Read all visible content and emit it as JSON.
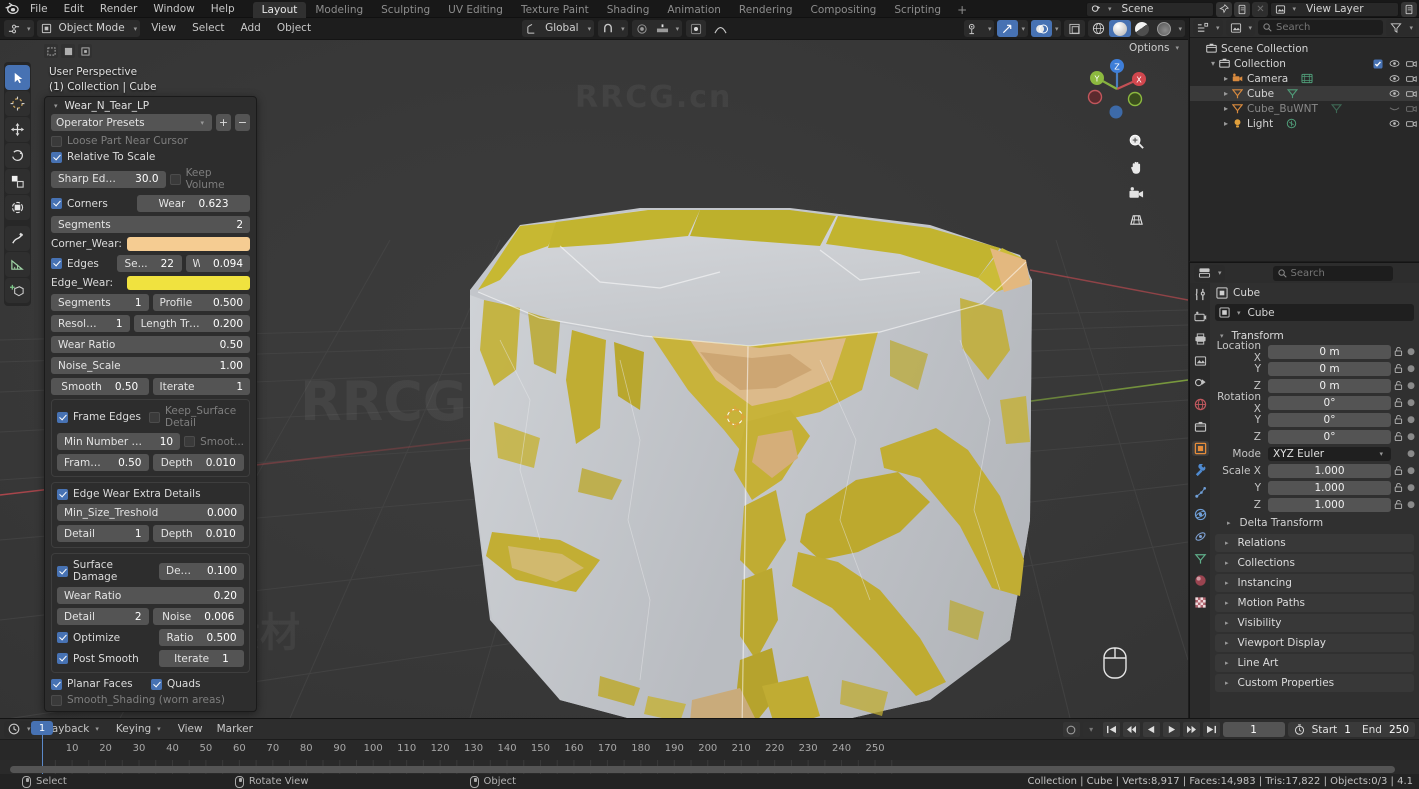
{
  "app": {
    "name": "Blender",
    "version": "4.1"
  },
  "topbar": {
    "menus": [
      "File",
      "Edit",
      "Render",
      "Window",
      "Help"
    ],
    "workspaces": [
      {
        "label": "Layout",
        "active": true
      },
      {
        "label": "Modeling",
        "active": false
      },
      {
        "label": "Sculpting",
        "active": false
      },
      {
        "label": "UV Editing",
        "active": false
      },
      {
        "label": "Texture Paint",
        "active": false
      },
      {
        "label": "Shading",
        "active": false
      },
      {
        "label": "Animation",
        "active": false
      },
      {
        "label": "Rendering",
        "active": false
      },
      {
        "label": "Compositing",
        "active": false
      },
      {
        "label": "Scripting",
        "active": false
      }
    ],
    "add_workspace_label": "+",
    "scene_name": "Scene",
    "view_layer_name": "View Layer"
  },
  "viewport_header": {
    "mode": "Object Mode",
    "menus": [
      "View",
      "Select",
      "Add",
      "Object"
    ],
    "transform_orientation": "Global",
    "options_label": "Options"
  },
  "viewport": {
    "overlay_line1": "User Perspective",
    "overlay_line2": "(1) Collection | Cube",
    "gizmo_axes": [
      "X",
      "Y",
      "Z"
    ],
    "tools": [
      "tweak-select-tool",
      "cursor-tool",
      "move-tool",
      "rotate-tool",
      "scale-tool",
      "transform-tool",
      "annotate-tool",
      "measure-tool",
      "add-cube-tool"
    ],
    "nav_icons": [
      "zoom-icon",
      "pan-hand-icon",
      "camera-view-icon",
      "perspective-ortho-icon"
    ],
    "watermarks": [
      "RRCG.cn",
      "RRCG",
      "人人素材"
    ]
  },
  "operator_panel": {
    "title": "Wear_N_Tear_LP",
    "presets_label": "Operator Presets",
    "preset_add": "+",
    "preset_remove": "−",
    "fields": {
      "loose_part_near_cursor": {
        "label": "Loose Part Near Cursor",
        "checked": false,
        "enabled": false
      },
      "relative_to_scale": {
        "label": "Relative To Scale",
        "checked": true
      },
      "sharp_edge_angle": {
        "label": "Sharp Edge Angle",
        "value": "30.0"
      },
      "keep_volume": {
        "label": "Keep Volume",
        "checked": false
      },
      "corners": {
        "label": "Corners",
        "checked": true
      },
      "corners_wear": {
        "label": "Wear",
        "value": "0.623"
      },
      "corners_segments": {
        "label": "Segments",
        "value": "2"
      },
      "corner_wear_color_label": "Corner_Wear:",
      "corner_wear_color": "#f5cc92",
      "edges": {
        "label": "Edges",
        "checked": true
      },
      "edges_seg": {
        "label": "Se...",
        "value": "22"
      },
      "edges_wear": {
        "label": "Wear",
        "value": "0.094"
      },
      "edge_wear_color_label": "Edge_Wear:",
      "edge_wear_color": "#f0e23f",
      "segments": {
        "label": "Segments",
        "value": "1"
      },
      "profile": {
        "label": "Profile",
        "value": "0.500"
      },
      "resolution": {
        "label": "Resolution",
        "value": "1"
      },
      "length_treshold": {
        "label": "Length Treshold",
        "value": "0.200"
      },
      "wear_ratio_1": {
        "label": "Wear Ratio",
        "value": "0.50"
      },
      "noise_scale": {
        "label": "Noise_Scale",
        "value": "1.00"
      },
      "smooth": {
        "label": "Smooth",
        "value": "0.50"
      },
      "iterate_1": {
        "label": "Iterate",
        "value": "1"
      },
      "frame_edges": {
        "label": "Frame Edges",
        "checked": true
      },
      "keep_surface_detail": {
        "label": "Keep_Surface Detail",
        "checked": false,
        "enabled": false
      },
      "min_number_of_edges": {
        "label": "Min Number Of Edges",
        "value": "10"
      },
      "smoot": {
        "label": "Smoot...",
        "checked": false,
        "enabled": false
      },
      "frame_inset": {
        "label": "Frame Inset",
        "value": "0.50"
      },
      "frame_depth": {
        "label": "Depth",
        "value": "0.010"
      },
      "edge_wear_extra_details": {
        "label": "Edge Wear Extra Details",
        "checked": true
      },
      "min_size_treshold": {
        "label": "Min_Size_Treshold",
        "value": "0.000"
      },
      "extra_detail": {
        "label": "Detail",
        "value": "1"
      },
      "extra_depth": {
        "label": "Depth",
        "value": "0.010"
      },
      "surface_damage": {
        "label": "Surface Damage",
        "checked": true
      },
      "surface_depth": {
        "label": "Depth",
        "value": "0.100"
      },
      "wear_ratio_2": {
        "label": "Wear Ratio",
        "value": "0.20"
      },
      "surface_detail": {
        "label": "Detail",
        "value": "2"
      },
      "surface_noise": {
        "label": "Noise",
        "value": "0.006"
      },
      "optimize": {
        "label": "Optimize",
        "checked": true
      },
      "optimize_ratio": {
        "label": "Ratio",
        "value": "0.500"
      },
      "post_smooth": {
        "label": "Post Smooth",
        "checked": true
      },
      "post_iterate": {
        "label": "Iterate",
        "value": "1"
      },
      "planar_faces": {
        "label": "Planar Faces",
        "checked": true
      },
      "quads": {
        "label": "Quads",
        "checked": true
      },
      "smooth_shading": {
        "label": "Smooth_Shading (worn areas)",
        "checked": false,
        "enabled": false
      }
    }
  },
  "outliner": {
    "search_placeholder": "Search",
    "items": [
      {
        "name": "Scene Collection",
        "indent": 0,
        "icon": "collection-icon",
        "dim": false,
        "disclosure": "",
        "visible": false
      },
      {
        "name": "Collection",
        "indent": 1,
        "icon": "collection-icon",
        "dim": false,
        "disclosure": "▾",
        "visible": true,
        "checkbox": true
      },
      {
        "name": "Camera",
        "indent": 2,
        "icon": "camera-icon",
        "dim": false,
        "disclosure": "▸",
        "visible": true
      },
      {
        "name": "Cube",
        "indent": 2,
        "icon": "mesh-icon",
        "dim": false,
        "disclosure": "▸",
        "visible": true,
        "selected": true
      },
      {
        "name": "Cube_BuWNT",
        "indent": 2,
        "icon": "mesh-icon",
        "dim": true,
        "disclosure": "▸",
        "visible": false
      },
      {
        "name": "Light",
        "indent": 2,
        "icon": "light-icon",
        "dim": false,
        "disclosure": "▸",
        "visible": true
      }
    ]
  },
  "properties": {
    "search_placeholder": "Search",
    "breadcrumb_object": "Cube",
    "id_name": "Cube",
    "transform": {
      "header": "Transform",
      "rows": [
        {
          "label": "Location X",
          "value": "0 m"
        },
        {
          "label": "Y",
          "value": "0 m"
        },
        {
          "label": "Z",
          "value": "0 m"
        },
        {
          "label": "Rotation X",
          "value": "0°"
        },
        {
          "label": "Y",
          "value": "0°"
        },
        {
          "label": "Z",
          "value": "0°"
        }
      ],
      "mode_label": "Mode",
      "mode_value": "XYZ Euler",
      "scale_rows": [
        {
          "label": "Scale X",
          "value": "1.000"
        },
        {
          "label": "Y",
          "value": "1.000"
        },
        {
          "label": "Z",
          "value": "1.000"
        }
      ],
      "delta_transform": "Delta Transform"
    },
    "sections": [
      "Relations",
      "Collections",
      "Instancing",
      "Motion Paths",
      "Visibility",
      "Viewport Display",
      "Line Art",
      "Custom Properties"
    ],
    "tabs": [
      "tool-icon",
      "render-icon",
      "output-icon",
      "view-layer-icon",
      "scene-icon",
      "world-icon",
      "collection-icon",
      "object-icon",
      "modifier-icon",
      "particles-icon",
      "physics-icon",
      "constraints-icon",
      "data-icon",
      "material-icon",
      "texture-icon"
    ]
  },
  "timeline": {
    "menus": [
      "Playback",
      "Keying",
      "View",
      "Marker"
    ],
    "current_frame": "1",
    "start_label": "Start",
    "start_value": "1",
    "end_label": "End",
    "end_value": "250",
    "ticks": [
      10,
      20,
      30,
      40,
      50,
      60,
      70,
      80,
      90,
      100,
      110,
      120,
      130,
      140,
      150,
      160,
      170,
      180,
      190,
      200,
      210,
      220,
      230,
      240,
      250
    ],
    "playhead_frame": "1"
  },
  "statusbar": {
    "hints": [
      {
        "icon": "mouse-left-icon",
        "label": "Select"
      },
      {
        "icon": "mouse-middle-icon",
        "label": "Rotate View"
      },
      {
        "icon": "mouse-right-icon",
        "label": "Object"
      }
    ],
    "stats": "Collection | Cube | Verts:8,917 | Faces:14,983 | Tris:17,822 | Objects:0/3 | 4.1"
  },
  "colors": {
    "accent_blue": "#4772b3",
    "corner_wear": "#f5cc92",
    "edge_wear": "#f0e23f",
    "axis_x": "#c04a4a",
    "axis_y": "#7fa63a"
  }
}
